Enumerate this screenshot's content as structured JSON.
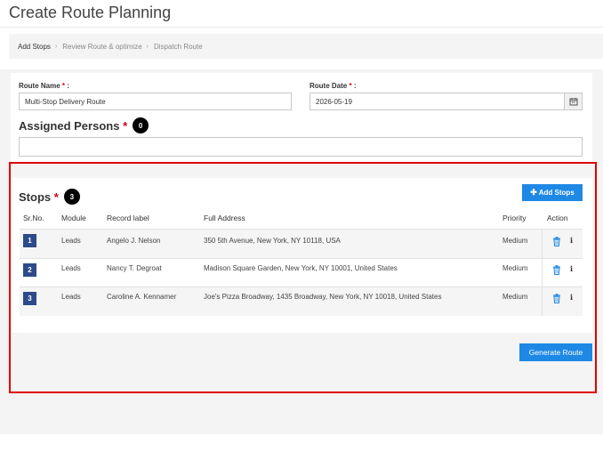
{
  "page": {
    "title": "Create Route Planning"
  },
  "breadcrumb": {
    "steps": [
      "Add Stops",
      "Review Route & optimize",
      "Dispatch Route"
    ],
    "separator": "›"
  },
  "form": {
    "route_name_label": "Route Name",
    "route_name_value": "Multi-Stop Delivery Route",
    "route_date_label": "Route Date",
    "route_date_value": "2026-05-19",
    "required_mark": "*",
    "label_colon": ":",
    "assigned_label": "Assigned Persons",
    "assigned_count": "0",
    "assigned_value": ""
  },
  "stops": {
    "heading": "Stops",
    "count": "3",
    "add_button": "Add Stops",
    "columns": [
      "Sr.No.",
      "Module",
      "Record label",
      "Full Address",
      "Priority",
      "Action"
    ],
    "rows": [
      {
        "no": "1",
        "module": "Leads",
        "label": "Angelo J. Nelson",
        "address": "350 5th Avenue, New York, NY 10118, USA",
        "priority": "Medium"
      },
      {
        "no": "2",
        "module": "Leads",
        "label": "Nancy T. Degroat",
        "address": "Madison Square Garden, New York, NY 10001, United States",
        "priority": "Medium"
      },
      {
        "no": "3",
        "module": "Leads",
        "label": "Caroline A. Kennamer",
        "address": "Joe's Pizza Broadway, 1435 Broadway, New York, NY 10018, United States",
        "priority": "Medium"
      }
    ],
    "info_glyph": "i"
  },
  "generate_button": "Generate Route",
  "colors": {
    "accent": "#1e88e5",
    "required": "#d0021b",
    "highlight_border": "#e00000",
    "badge_number": "#2d4a8a"
  },
  "icons": {
    "calendar": "calendar-icon",
    "delete": "trash-icon",
    "info": "info-icon",
    "plus": "plus-icon"
  }
}
